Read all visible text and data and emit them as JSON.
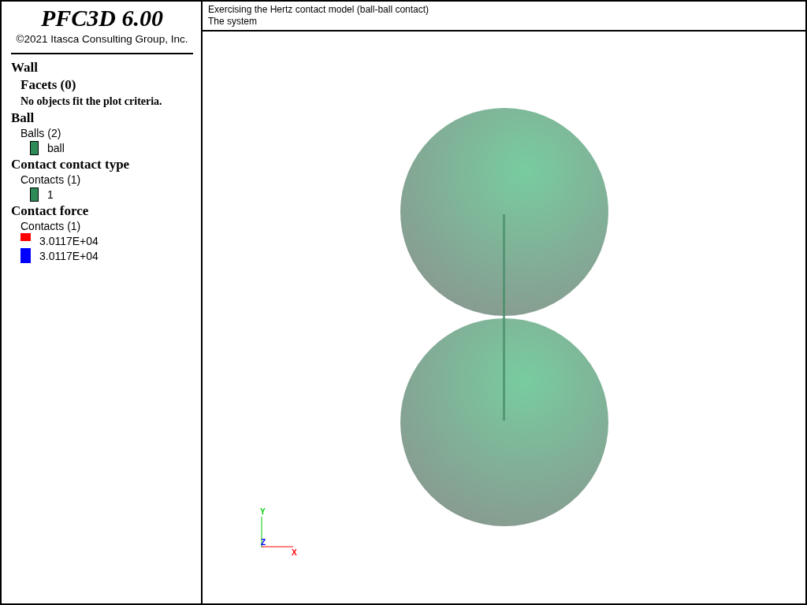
{
  "sidebar": {
    "title": "PFC3D 6.00",
    "copyright": "©2021 Itasca Consulting Group, Inc.",
    "sections": [
      {
        "heading": "Wall",
        "groups": [
          {
            "label": "Facets (0)",
            "kind": "empty",
            "message": "No objects fit the plot criteria."
          }
        ]
      },
      {
        "heading": "Ball",
        "groups": [
          {
            "label": "Balls (2)",
            "kind": "list",
            "entries": [
              {
                "label": "ball",
                "color": "#2e8b57"
              }
            ]
          }
        ]
      },
      {
        "heading": "Contact contact type",
        "groups": [
          {
            "label": "Contacts (1)",
            "kind": "list",
            "entries": [
              {
                "label": "1",
                "color": "#2e8b57"
              }
            ]
          }
        ]
      },
      {
        "heading": "Contact force",
        "groups": [
          {
            "label": "Contacts (1)",
            "kind": "scale",
            "entries": [
              {
                "label": "3.0117E+04",
                "color": "#ff0000"
              },
              {
                "label": "3.0117E+04",
                "color": "#0000ff"
              }
            ]
          }
        ]
      }
    ]
  },
  "viewport": {
    "title_lines": [
      "Exercising the Hertz contact model (ball-ball contact)",
      "The system"
    ],
    "axes": [
      {
        "label": "Y",
        "color": "#00cc00"
      },
      {
        "label": "Z",
        "color": "#0000ff"
      },
      {
        "label": "X",
        "color": "#ff0000"
      }
    ]
  }
}
